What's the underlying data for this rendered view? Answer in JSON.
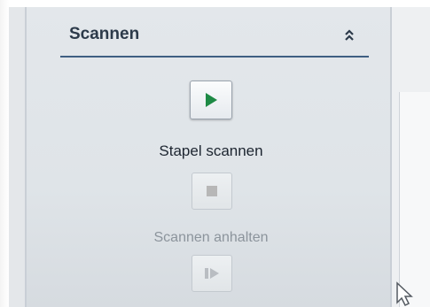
{
  "panel": {
    "title": "Scannen",
    "collapse_icon": "double-chevron-up-icon"
  },
  "actions": [
    {
      "label": "Stapel scannen",
      "icon": "play-icon",
      "icon_color": "#1e8a45",
      "enabled": true
    },
    {
      "label": "Scannen anhalten",
      "icon": "stop-icon",
      "icon_color": "#b7b7b7",
      "enabled": false
    },
    {
      "label": "",
      "icon": "step-forward-icon",
      "icon_color": "#b9bdc2",
      "enabled": false
    }
  ],
  "colors": {
    "accent_rule": "#3f5f82",
    "title_text": "#2c3a4a",
    "play_green": "#1e8a45"
  }
}
